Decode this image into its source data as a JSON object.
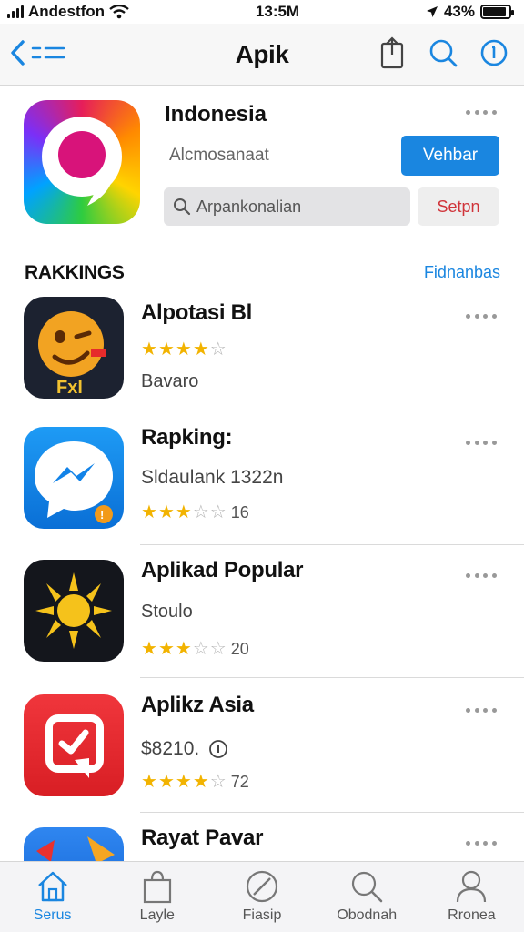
{
  "status_bar": {
    "carrier": "Andestfon",
    "time": "13:5M",
    "battery_pct": "43%"
  },
  "nav": {
    "title": "Apik",
    "back_label": "≡≡"
  },
  "featured": {
    "title": "Indonesia",
    "subtitle": "Alcmosanaat",
    "view_button": "Vehbar",
    "search_placeholder": "Arpankonalian",
    "search_button": "Setpn"
  },
  "section": {
    "title": "RAKKINGS",
    "link": "Fidnanbas"
  },
  "apps": [
    {
      "name": "Alpotasi Bl",
      "meta": "Bavaro",
      "rating": 4,
      "rating_count": ""
    },
    {
      "name": "Rapking:",
      "meta": "Sldaulank 1322n",
      "rating": 3,
      "rating_count": "16"
    },
    {
      "name": "Aplikad Popular",
      "meta": "Stoulo",
      "rating": 3,
      "rating_count": "20"
    },
    {
      "name": "Aplikz Asia",
      "meta": "$8210.",
      "rating": 4,
      "rating_count": "72"
    },
    {
      "name": "Rayat Pavar",
      "meta": "",
      "rating": 0,
      "rating_count": ""
    }
  ],
  "tabs": [
    {
      "label": "Serus",
      "icon": "home-icon"
    },
    {
      "label": "Layle",
      "icon": "bag-icon"
    },
    {
      "label": "Fiasip",
      "icon": "compass-icon"
    },
    {
      "label": "Obodnah",
      "icon": "search-icon"
    },
    {
      "label": "Rronea",
      "icon": "person-icon"
    }
  ],
  "colors": {
    "accent": "#1a86e0",
    "star": "#f2b300",
    "danger": "#d0343a"
  }
}
